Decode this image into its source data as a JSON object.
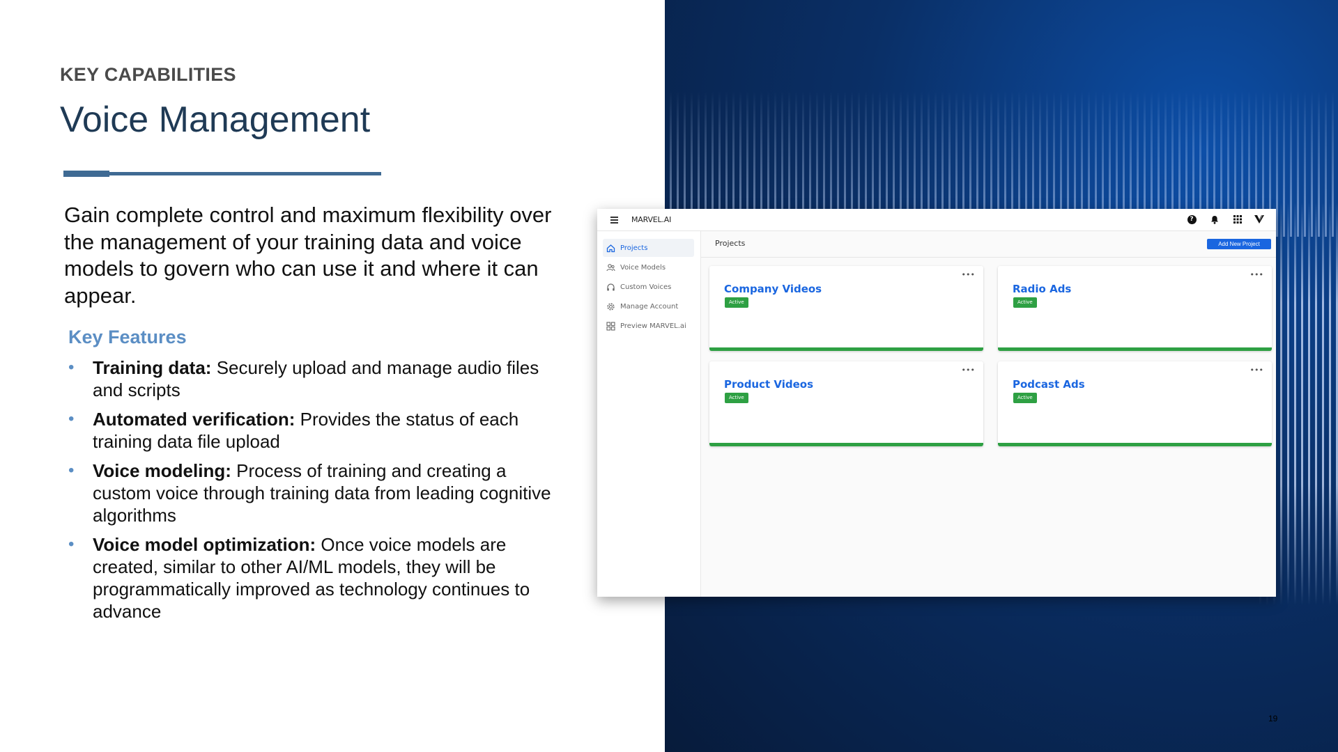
{
  "slide": {
    "eyebrow": "KEY CAPABILITIES",
    "title": "Voice Management",
    "intro": "Gain complete control and maximum flexibility over the management of your training data and voice models to govern who can use it and where it can appear.",
    "key_features_title": "Key Features",
    "features": [
      {
        "term": "Training data:",
        "text": " Securely upload and manage audio files and scripts"
      },
      {
        "term": "Automated verification:",
        "text": " Provides the status of each training data file upload"
      },
      {
        "term": "Voice modeling:",
        "text": " Process of training and creating a custom voice through training data from leading cognitive algorithms"
      },
      {
        "term": "Voice model optimization:",
        "text": " Once voice models are created, similar to other AI/ML models, they will be programmatically improved as technology continues to advance"
      }
    ],
    "page_number": "19",
    "accent_color": "#3f6a93"
  },
  "app": {
    "brand": "MARVEL.AI",
    "nav": [
      {
        "label": "Projects",
        "icon": "home-icon",
        "active": true
      },
      {
        "label": "Voice Models",
        "icon": "users-icon",
        "active": false
      },
      {
        "label": "Custom Voices",
        "icon": "headphones-icon",
        "active": false
      },
      {
        "label": "Manage Account",
        "icon": "gear-icon",
        "active": false
      },
      {
        "label": "Preview MARVEL.ai",
        "icon": "apps-icon",
        "active": false
      }
    ],
    "main_title": "Projects",
    "add_button": "Add New Project",
    "projects": [
      {
        "name": "Company Videos",
        "status": "Active"
      },
      {
        "name": "Radio Ads",
        "status": "Active"
      },
      {
        "name": "Product Videos",
        "status": "Active"
      },
      {
        "name": "Podcast Ads",
        "status": "Active"
      }
    ],
    "more_glyph": "•••",
    "help_glyph": "?",
    "primary_color": "#1a66e0",
    "status_color": "#2ea043"
  }
}
